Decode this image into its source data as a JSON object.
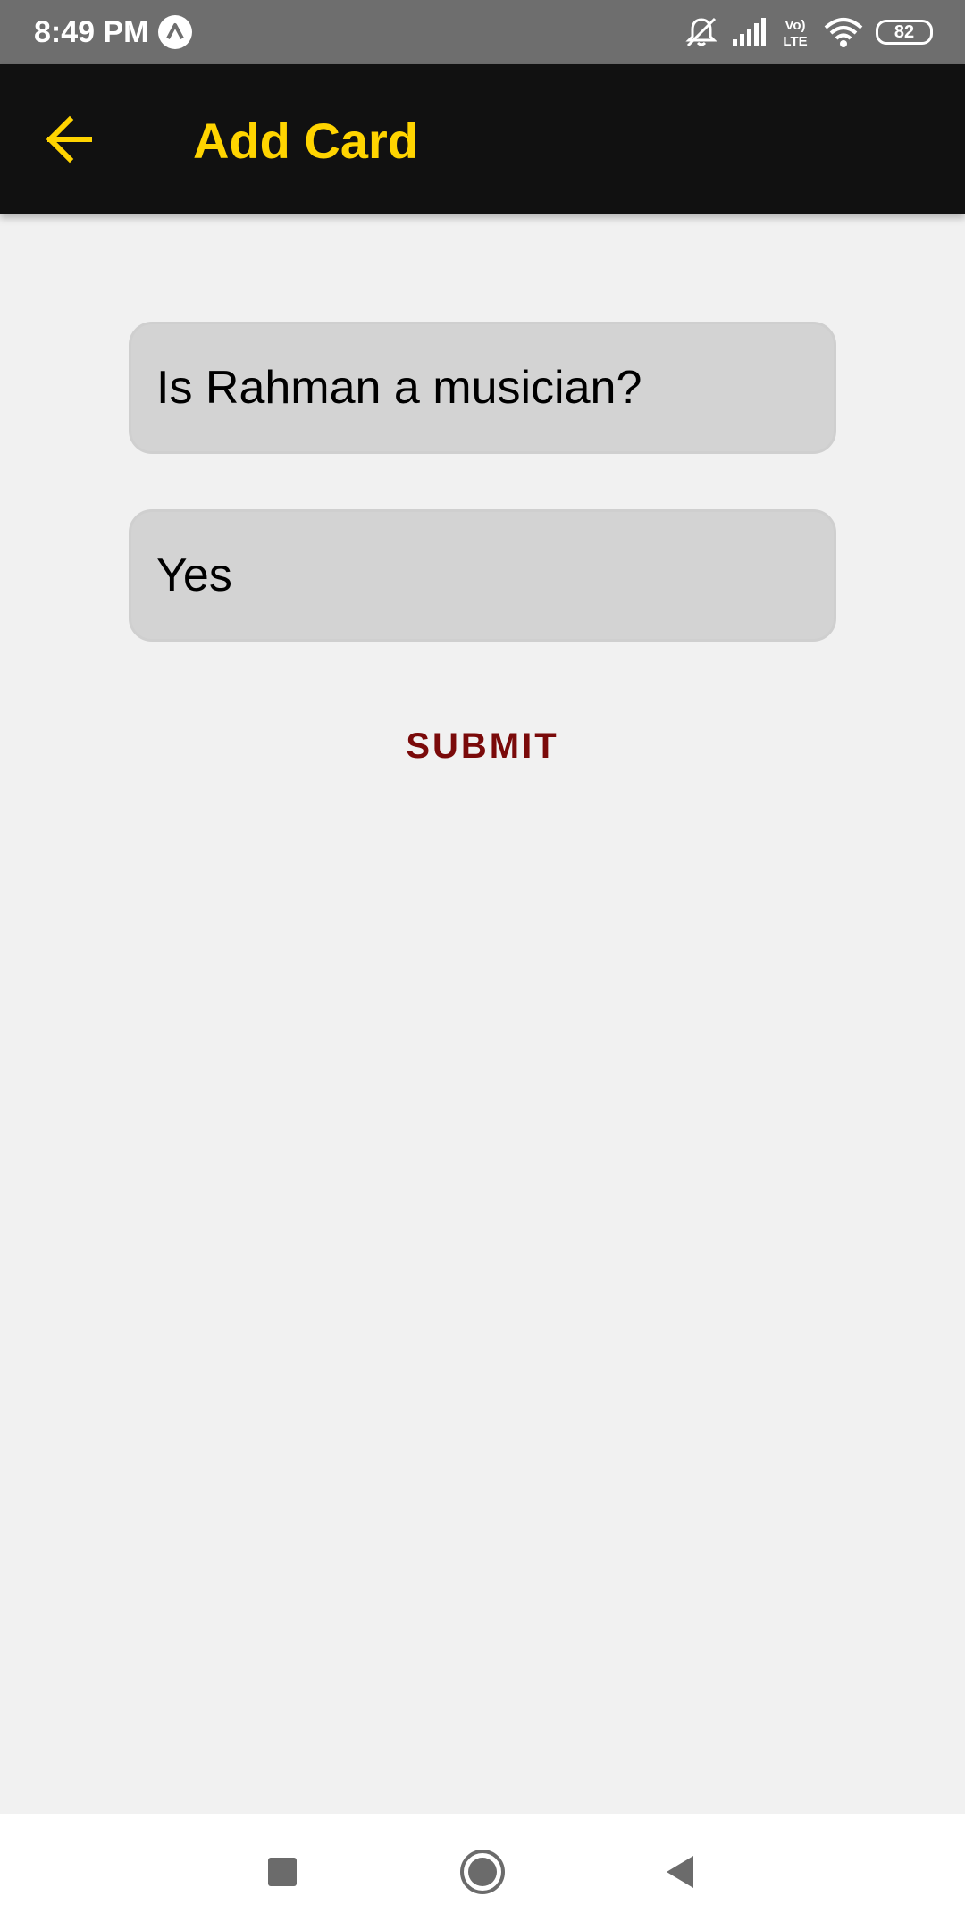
{
  "status_bar": {
    "time": "8:49 PM",
    "battery": "82",
    "network_label": "Vo) LTE",
    "icons": [
      "app-notification-icon",
      "muted-bell-icon",
      "signal-icon",
      "volte-icon",
      "wifi-icon",
      "battery-icon"
    ]
  },
  "app_bar": {
    "back_icon": "arrow-left-icon",
    "title": "Add Card",
    "title_color": "#ffd400",
    "background": "#111111"
  },
  "form": {
    "question_value": "Is Rahman a musician?",
    "answer_value": "Yes",
    "submit_label": "SUBMIT",
    "submit_color": "#7a0a0a"
  },
  "nav_bar": {
    "buttons": [
      "recents-square-icon",
      "home-circle-icon",
      "back-triangle-icon"
    ]
  }
}
